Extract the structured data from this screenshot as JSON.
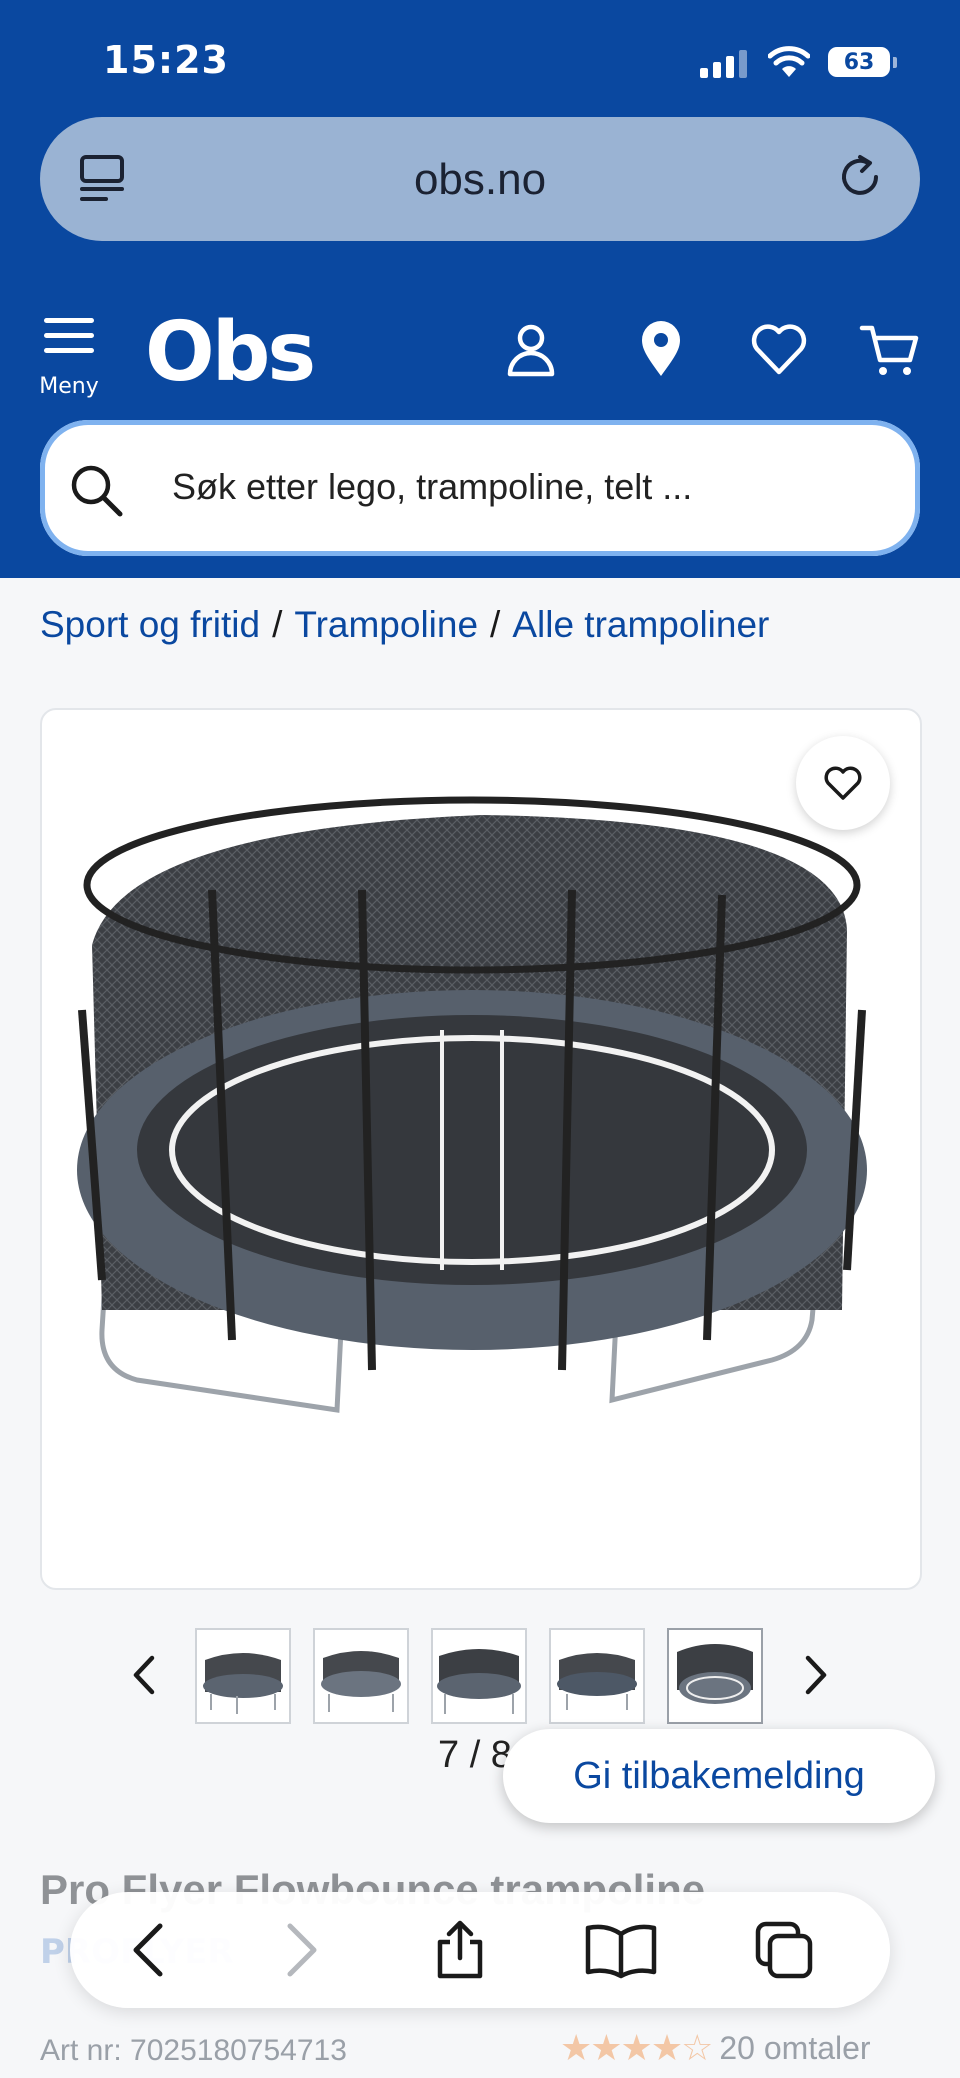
{
  "status_bar": {
    "time": "15:23",
    "battery": "63"
  },
  "browser": {
    "url": "obs.no"
  },
  "header": {
    "menu_label": "Meny",
    "logo_text": "Obs",
    "search_placeholder": "Søk etter lego, trampoline, telt ..."
  },
  "breadcrumb": [
    "Sport og fritid",
    "Trampoline",
    "Alle trampoliner"
  ],
  "gallery": {
    "counter": "7 / 8",
    "thumbnail_count": 5
  },
  "feedback_button": "Gi tilbakemelding",
  "product": {
    "title": "Pro Flyer Flowbounce trampoline",
    "brand": "PROFLYER",
    "article_nr": "Art nr: 7025180754713",
    "rating_stars": 4.5,
    "reviews": "20 omtaler"
  },
  "colors": {
    "brand_blue": "#0a48a0",
    "url_bar": "#9ab3d3"
  }
}
